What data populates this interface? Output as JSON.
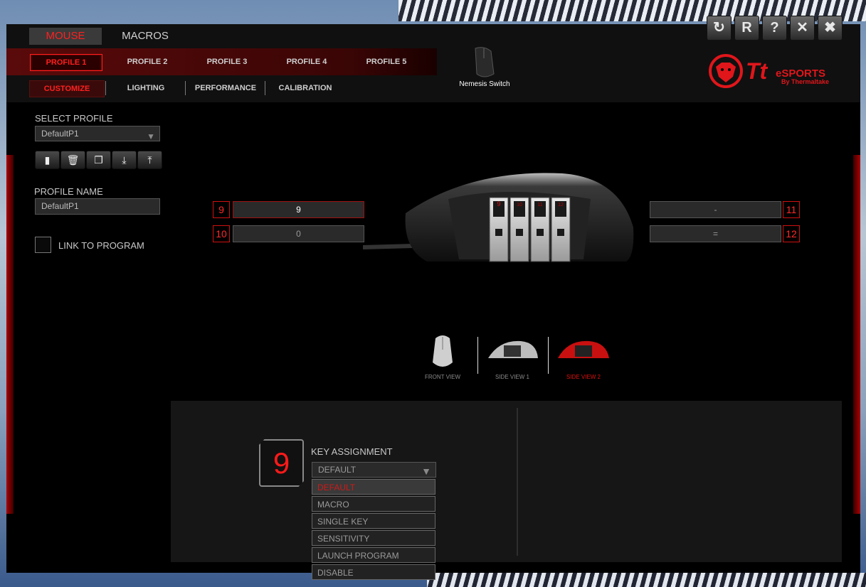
{
  "main_tabs": {
    "mouse": "MOUSE",
    "macros": "MACROS"
  },
  "profile_tabs": [
    "PROFILE 1",
    "PROFILE 2",
    "PROFILE 3",
    "PROFILE 4",
    "PROFILE 5"
  ],
  "sub_tabs": [
    "CUSTOMIZE",
    "LIGHTING",
    "PERFORMANCE",
    "CALIBRATION"
  ],
  "window_buttons": [
    "refresh-icon",
    "reset-icon",
    "help-icon",
    "close-icon",
    "tools-icon"
  ],
  "window_glyphs": {
    "refresh": "↻",
    "reset": "R",
    "help": "?",
    "close": "✕",
    "tools": "✖"
  },
  "brand": {
    "tt": "Tt",
    "esports": "eSPORTS",
    "by": "By Thermaltake",
    "color": "#e0161b"
  },
  "device": {
    "name": "Nemesis Switch"
  },
  "sidebar": {
    "select_profile_label": "SELECT PROFILE",
    "select_profile_value": "DefaultP1",
    "profile_name_label": "PROFILE NAME",
    "profile_name_value": "DefaultP1",
    "link_to_program_label": "LINK TO PROGRAM",
    "tool_icons": [
      "save-icon",
      "delete-icon",
      "copy-icon",
      "import-icon",
      "export-icon"
    ]
  },
  "keys_left": [
    {
      "num": "9",
      "value": "9",
      "active": true
    },
    {
      "num": "10",
      "value": "0",
      "active": false
    }
  ],
  "keys_right": [
    {
      "num": "11",
      "value": "-"
    },
    {
      "num": "12",
      "value": "="
    }
  ],
  "mouse_side_keys": [
    "9",
    "10",
    "11",
    "12"
  ],
  "views": [
    {
      "label": "FRONT VIEW",
      "active": false
    },
    {
      "label": "SIDE VIEW 1",
      "active": false
    },
    {
      "label": "SIDE VIEW 2",
      "active": true
    }
  ],
  "assignment": {
    "key_number": "9",
    "label": "KEY ASSIGNMENT",
    "selected": "DEFAULT",
    "options": [
      "DEFAULT",
      "MACRO",
      "SINGLE KEY",
      "SENSITIVITY",
      "LAUNCH PROGRAM",
      "DISABLE"
    ]
  }
}
